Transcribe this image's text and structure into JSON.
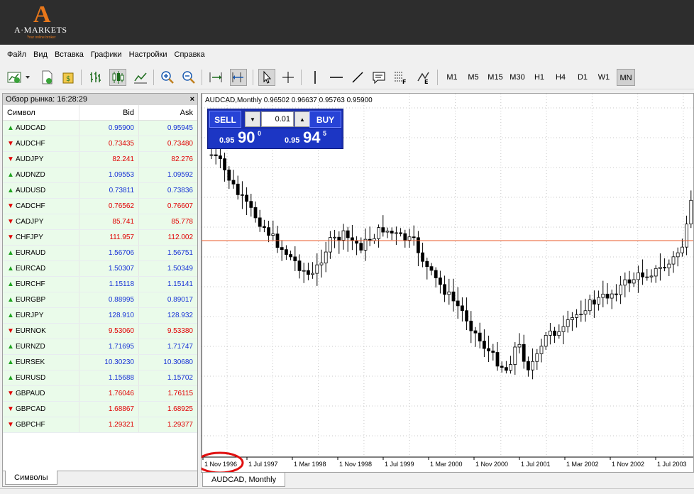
{
  "brand": {
    "logo_letter": "A",
    "name": "A·MARKETS",
    "tagline": "Your online broker"
  },
  "menu": [
    "Файл",
    "Вид",
    "Вставка",
    "Графики",
    "Настройки",
    "Справка"
  ],
  "timeframes": [
    "M1",
    "M5",
    "M15",
    "M30",
    "H1",
    "H4",
    "D1",
    "W1",
    "MN"
  ],
  "active_timeframe": "MN",
  "market_watch": {
    "title": "Обзор рынка: 16:28:29",
    "close": "×",
    "columns": [
      "Символ",
      "Bid",
      "Ask"
    ],
    "rows": [
      {
        "symbol": "AUDCAD",
        "bid": "0.95900",
        "ask": "0.95945",
        "dir": "up"
      },
      {
        "symbol": "AUDCHF",
        "bid": "0.73435",
        "ask": "0.73480",
        "dir": "down"
      },
      {
        "symbol": "AUDJPY",
        "bid": "82.241",
        "ask": "82.276",
        "dir": "down"
      },
      {
        "symbol": "AUDNZD",
        "bid": "1.09553",
        "ask": "1.09592",
        "dir": "up"
      },
      {
        "symbol": "AUDUSD",
        "bid": "0.73811",
        "ask": "0.73836",
        "dir": "up"
      },
      {
        "symbol": "CADCHF",
        "bid": "0.76562",
        "ask": "0.76607",
        "dir": "down"
      },
      {
        "symbol": "CADJPY",
        "bid": "85.741",
        "ask": "85.778",
        "dir": "down"
      },
      {
        "symbol": "CHFJPY",
        "bid": "111.957",
        "ask": "112.002",
        "dir": "down"
      },
      {
        "symbol": "EURAUD",
        "bid": "1.56706",
        "ask": "1.56751",
        "dir": "up"
      },
      {
        "symbol": "EURCAD",
        "bid": "1.50307",
        "ask": "1.50349",
        "dir": "up"
      },
      {
        "symbol": "EURCHF",
        "bid": "1.15118",
        "ask": "1.15141",
        "dir": "up"
      },
      {
        "symbol": "EURGBP",
        "bid": "0.88995",
        "ask": "0.89017",
        "dir": "up"
      },
      {
        "symbol": "EURJPY",
        "bid": "128.910",
        "ask": "128.932",
        "dir": "up"
      },
      {
        "symbol": "EURNOK",
        "bid": "9.53060",
        "ask": "9.53380",
        "dir": "down"
      },
      {
        "symbol": "EURNZD",
        "bid": "1.71695",
        "ask": "1.71747",
        "dir": "up"
      },
      {
        "symbol": "EURSEK",
        "bid": "10.30230",
        "ask": "10.30680",
        "dir": "up"
      },
      {
        "symbol": "EURUSD",
        "bid": "1.15688",
        "ask": "1.15702",
        "dir": "up"
      },
      {
        "symbol": "GBPAUD",
        "bid": "1.76046",
        "ask": "1.76115",
        "dir": "down"
      },
      {
        "symbol": "GBPCAD",
        "bid": "1.68867",
        "ask": "1.68925",
        "dir": "down"
      },
      {
        "symbol": "GBPCHF",
        "bid": "1.29321",
        "ask": "1.29377",
        "dir": "down"
      }
    ],
    "tab": "Символы"
  },
  "chart": {
    "header": "AUDCAD,Monthly  0.96502 0.96637 0.95763 0.95900",
    "tab": "AUDCAD, Monthly",
    "line_color": "#e85a2a",
    "x_labels": [
      "1 Nov 1996",
      "1 Jul 1997",
      "1 Mar 1998",
      "1 Nov 1998",
      "1 Jul 1999",
      "1 Mar 2000",
      "1 Nov 2000",
      "1 Jul 2001",
      "1 Mar 2002",
      "1 Nov 2002",
      "1 Jul 2003"
    ],
    "highlight_label": "1 Nov 1996"
  },
  "trade_panel": {
    "sell_label": "SELL",
    "buy_label": "BUY",
    "lot": "0.01",
    "sell_small": "0.95",
    "sell_big": "90",
    "sell_sup": "0",
    "buy_small": "0.95",
    "buy_big": "94",
    "buy_sup": "5"
  }
}
